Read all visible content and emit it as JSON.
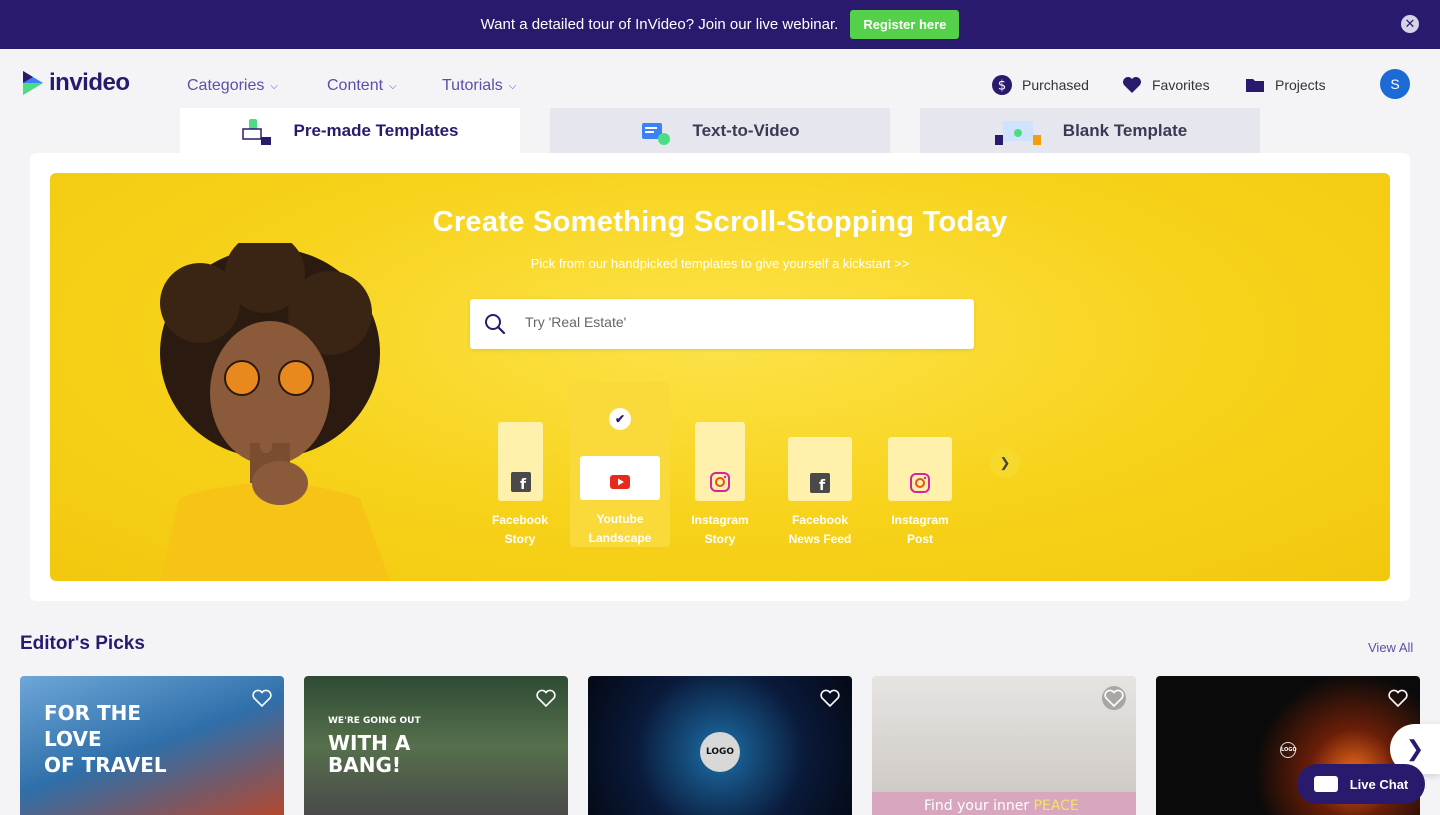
{
  "banner": {
    "message": "Want a detailed tour of InVideo? Join our live webinar.",
    "cta": "Register here",
    "close_icon": "close-icon"
  },
  "nav": {
    "brand": "invideo",
    "menus": [
      {
        "label": "Categories"
      },
      {
        "label": "Content"
      },
      {
        "label": "Tutorials"
      }
    ],
    "purchased": "Purchased",
    "favorites": "Favorites",
    "projects": "Projects",
    "avatar_initial": "S"
  },
  "tabs": [
    {
      "label": "Pre-made Templates",
      "active": true
    },
    {
      "label": "Text-to-Video",
      "active": false
    },
    {
      "label": "Blank Template",
      "active": false
    }
  ],
  "hero": {
    "title": "Create Something Scroll-Stopping Today",
    "subtitle": "Pick from our handpicked templates to give yourself a kickstart >>",
    "search_placeholder": "Try 'Real Estate'"
  },
  "formats": [
    {
      "line1": "Facebook",
      "line2": "Story",
      "icon": "facebook-icon",
      "selected": false
    },
    {
      "line1": "Youtube",
      "line2": "Landscape",
      "icon": "youtube-icon",
      "selected": true
    },
    {
      "line1": "Instagram",
      "line2": "Story",
      "icon": "instagram-icon",
      "selected": false
    },
    {
      "line1": "Facebook",
      "line2": "News Feed",
      "icon": "facebook-icon",
      "selected": false
    },
    {
      "line1": "Instagram",
      "line2": "Post",
      "icon": "instagram-icon",
      "selected": false
    }
  ],
  "editors_picks": {
    "title": "Editor's Picks",
    "view_all": "View All",
    "templates": [
      {
        "text_lines": [
          "FOR THE",
          "LOVE",
          "OF TRAVEL"
        ]
      },
      {
        "text_lines": [
          "WE'RE GOING OUT",
          "WITH A",
          "BANG!"
        ]
      },
      {
        "text_lines": [
          "LOGO"
        ]
      },
      {
        "text_lines": [
          "Find your inner",
          "PEACE"
        ]
      },
      {
        "text_lines": [
          "LOGO"
        ]
      }
    ]
  },
  "live_chat": "Live Chat",
  "colors": {
    "brand": "#2a1a6e",
    "accent_green": "#55d04a",
    "hero_yellow": "#f7d21a"
  }
}
